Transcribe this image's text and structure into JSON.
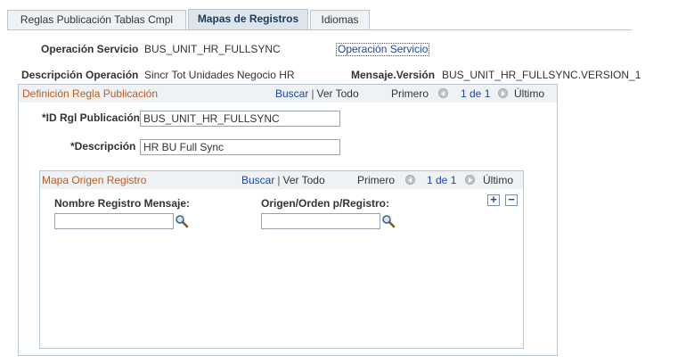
{
  "tabs": [
    {
      "label": "Reglas Publicación Tablas Cmpl",
      "active": false
    },
    {
      "label": "Mapas de Registros",
      "active": true
    },
    {
      "label": "Idiomas",
      "active": false
    }
  ],
  "header": {
    "operacion_servicio_label": "Operación Servicio",
    "operacion_servicio_value": "BUS_UNIT_HR_FULLSYNC",
    "operacion_servicio_link": "Operación Servicio",
    "descripcion_operacion_label": "Descripción Operación",
    "descripcion_operacion_value": "Sincr Tot Unidades Negocio HR",
    "mensaje_version_label": "Mensaje.Versión",
    "mensaje_version_value": "BUS_UNIT_HR_FULLSYNC.VERSION_1"
  },
  "regla_group": {
    "title": "Definición Regla Publicación",
    "buscar": "Buscar",
    "ver_todo": "Ver Todo",
    "primero": "Primero",
    "count": "1 de 1",
    "ultimo": "Último",
    "id_label": "*ID Rgl Publicación",
    "id_value": "BUS_UNIT_HR_FULLSYNC",
    "desc_label": "*Descripción",
    "desc_value": "HR BU Full Sync"
  },
  "mapa_group": {
    "title": "Mapa Origen Registro",
    "buscar": "Buscar",
    "ver_todo": "Ver Todo",
    "primero": "Primero",
    "count": "1 de 1",
    "ultimo": "Último",
    "add_label": "+",
    "remove_label": "−",
    "nombre_label": "Nombre Registro Mensaje:",
    "nombre_value": "",
    "origen_label": "Origen/Orden p/Registro:",
    "origen_value": ""
  },
  "colors": {
    "accent_link": "#1a47a3",
    "group_title": "#c05a1c",
    "border": "#b9c6d3"
  }
}
